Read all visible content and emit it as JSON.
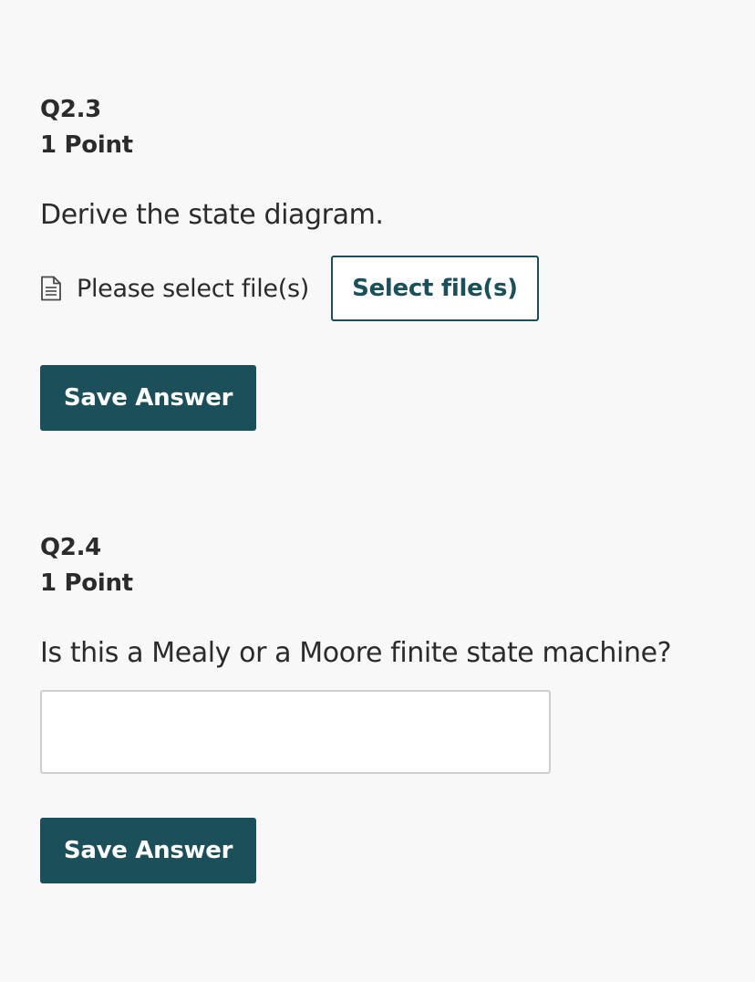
{
  "questions": [
    {
      "number": "Q2.3",
      "points": "1 Point",
      "prompt": "Derive the state diagram.",
      "file_status": "Please select file(s)",
      "select_files_label": "Select file(s)",
      "save_label": "Save Answer"
    },
    {
      "number": "Q2.4",
      "points": "1 Point",
      "prompt": "Is this a Mealy or a Moore finite state machine?",
      "answer_value": "",
      "answer_placeholder": "",
      "save_label": "Save Answer"
    }
  ],
  "colors": {
    "accent": "#1b4f5a",
    "background": "#f8f8f8",
    "text": "#2b2b2b"
  },
  "icons": {
    "file_icon": "document-icon"
  }
}
